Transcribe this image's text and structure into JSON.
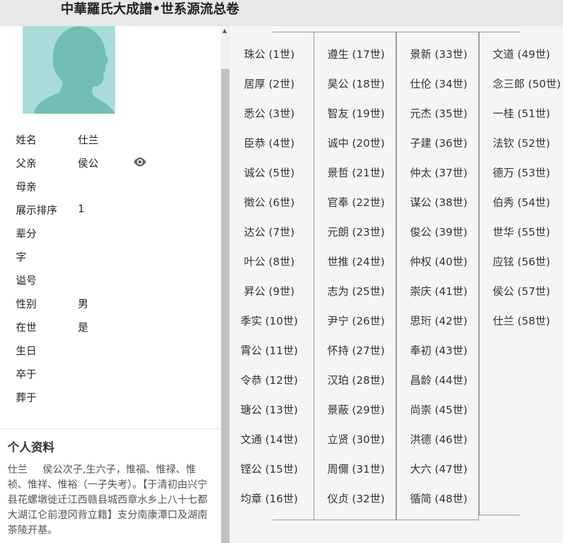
{
  "title": "中華羅氏大成譜•世系源流总卷",
  "profile": {
    "fields": [
      {
        "label": "姓名",
        "value": "仕兰"
      },
      {
        "label": "父亲",
        "value": "侯公"
      },
      {
        "label": "母亲",
        "value": ""
      },
      {
        "label": "展示排序",
        "value": "1"
      },
      {
        "label": "辈分",
        "value": ""
      },
      {
        "label": "字",
        "value": ""
      },
      {
        "label": "谥号",
        "value": ""
      },
      {
        "label": "性别",
        "value": "男"
      },
      {
        "label": "在世",
        "value": "是"
      },
      {
        "label": "生日",
        "value": ""
      },
      {
        "label": "卒于",
        "value": ""
      },
      {
        "label": "葬于",
        "value": ""
      }
    ],
    "bio_title": "个人资料",
    "bio_name": "仕兰",
    "bio_text": "侯公次子,生六子，惟福、惟禄、惟祯、惟祥、惟裕（一子失考）。【于清初由兴宁县花螺墩徙迁江西赣县城西章水乡上八十七都大湖江仑前澄冈背立籍】支分南康潭口及湖南茶陵开基。"
  },
  "generations": [
    [
      "珠公 (1世)",
      "居厚 (2世)",
      "悉公 (3世)",
      "臣恭 (4世)",
      "诚公 (5世)",
      "徵公 (6世)",
      "达公 (7世)",
      "叶公 (8世)",
      "昇公 (9世)",
      "季实 (10世)",
      "霄公 (11世)",
      "令恭 (12世)",
      "瑭公 (13世)",
      "文通 (14世)",
      "铿公 (15世)",
      "均章 (16世)"
    ],
    [
      "遵生 (17世)",
      "昊公 (18世)",
      "智友 (19世)",
      "诚中 (20世)",
      "景哲 (21世)",
      "官奉 (22世)",
      "元朗 (23世)",
      "世推 (24世)",
      "志为 (25世)",
      "尹宁 (26世)",
      "怀持 (27世)",
      "汉珀 (28世)",
      "景蔽 (29世)",
      "立贤 (30世)",
      "周儞 (31世)",
      "仪贞 (32世)"
    ],
    [
      "景新 (33世)",
      "仕伦 (34世)",
      "元杰 (35世)",
      "子建 (36世)",
      "仲太 (37世)",
      "谋公 (38世)",
      "俊公 (39世)",
      "仲权 (40世)",
      "崇庆 (41世)",
      "思珩 (42世)",
      "奉初 (43世)",
      "昌龄 (44世)",
      "尚崇 (45世)",
      "洪德 (46世)",
      "大六 (47世)",
      "循简 (48世)"
    ],
    [
      "文道 (49世)",
      "念三郎 (50世)",
      "一桂 (51世)",
      "法钦 (52世)",
      "德万 (53世)",
      "伯秀 (54世)",
      "世华 (55世)",
      "应铉 (56世)",
      "侯公 (57世)",
      "仕兰 (58世)"
    ]
  ]
}
